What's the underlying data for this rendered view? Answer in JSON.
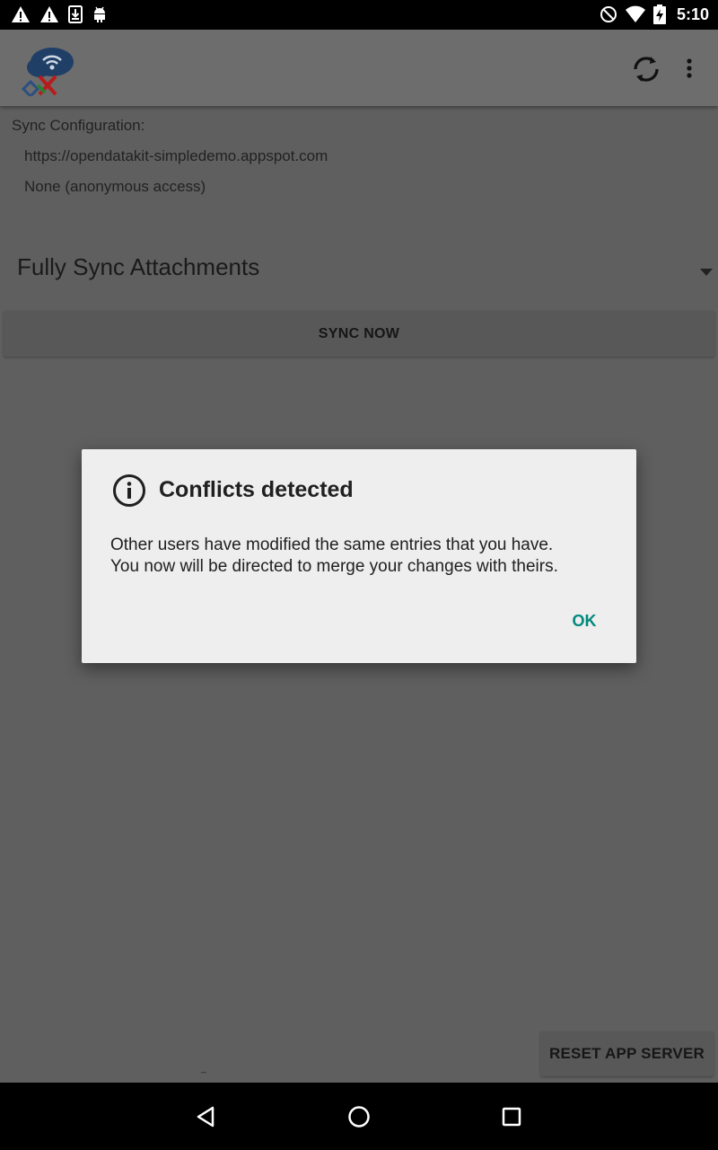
{
  "status_bar": {
    "time": "5:10",
    "left_icons": [
      "warning-icon",
      "warning-icon",
      "download-icon",
      "android-icon"
    ],
    "right_icons": [
      "do-not-disturb-icon",
      "wifi-icon",
      "battery-charging-icon"
    ]
  },
  "app_bar": {
    "logo_icon": "odk-x-logo",
    "actions": [
      "sync-icon",
      "overflow-menu-icon"
    ]
  },
  "sync_configuration": {
    "title": "Sync Configuration:",
    "server_url": "https://opendatakit-simpledemo.appspot.com",
    "auth": "None (anonymous access)"
  },
  "attachment_spinner": {
    "selected": "Fully Sync Attachments"
  },
  "buttons": {
    "sync_now": "SYNC NOW",
    "reset_app_server": "RESET APP SERVER"
  },
  "tiny_mark": "_",
  "dialog": {
    "icon": "info-icon",
    "title": "Conflicts detected",
    "message_line1": "Other users have modified the same entries that you have.",
    "message_line2": "You now will be directed to merge your changes with theirs.",
    "ok_label": "OK",
    "accent_color": "#00897b"
  },
  "nav_bar": {
    "icons": [
      "back-icon",
      "home-icon",
      "recents-icon"
    ]
  }
}
